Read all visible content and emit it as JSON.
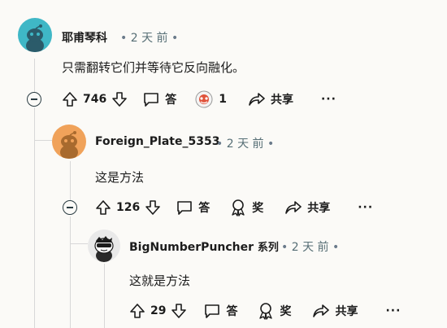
{
  "comments": [
    {
      "username": "耶甫琴科",
      "time": "2 天 前",
      "body": "只需翻转它们并等待它反向融化。",
      "votes": "746",
      "reply_label": "答",
      "award_count": "1",
      "share_label": "共享",
      "more_label": "···",
      "avatar_color": "#3fb7c6"
    },
    {
      "username": "Foreign_Plate_5353",
      "time": "2 天 前",
      "body": "这是方法",
      "votes": "126",
      "reply_label": "答",
      "award_label": "奖",
      "share_label": "共享",
      "more_label": "···",
      "avatar_color": "#f0a25a"
    },
    {
      "username": "BigNumberPuncher",
      "flair": "系列",
      "time": "2 天 前",
      "body": "这就是方法",
      "votes": "29",
      "reply_label": "答",
      "award_label": "奖",
      "share_label": "共享",
      "more_label": "···",
      "avatar_color": "#e9e9e9"
    }
  ],
  "separator_dot": "•"
}
